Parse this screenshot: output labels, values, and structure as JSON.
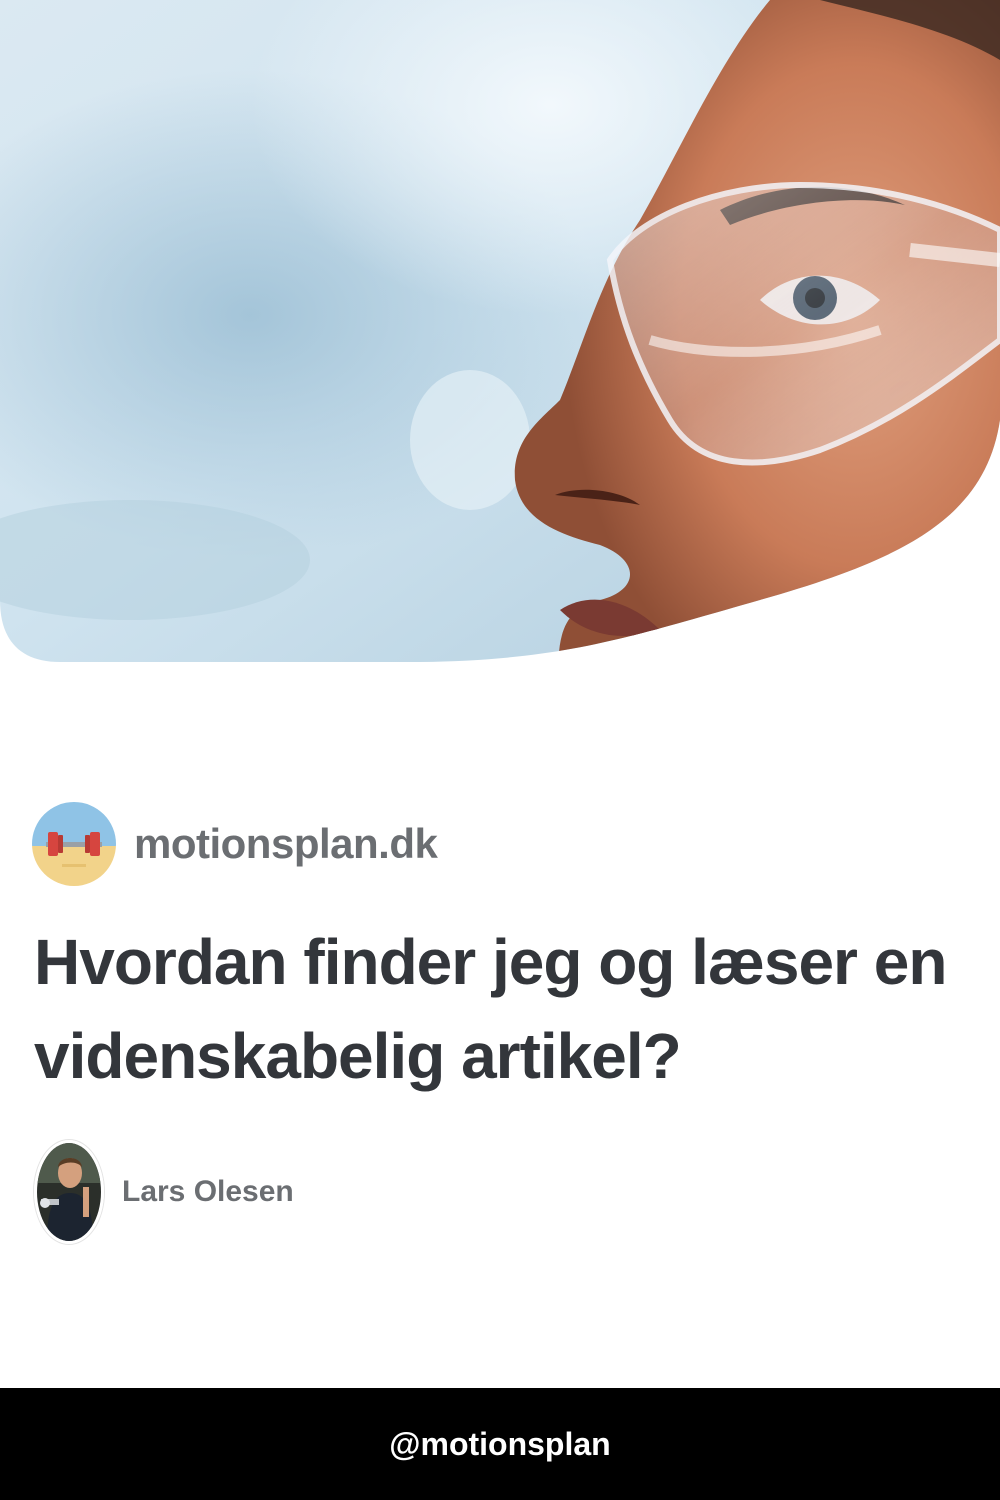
{
  "hero": {
    "image": "scientist-with-safety-glasses-photo"
  },
  "brand": {
    "name": "motionsplan.dk",
    "logo_icon": "dumbbell-icon"
  },
  "article": {
    "title": "Hvordan finder jeg og læser en videnskabelig artikel?"
  },
  "author": {
    "name": "Lars Olesen",
    "avatar": "author-photo"
  },
  "footer": {
    "handle": "@motionsplan"
  },
  "colors": {
    "headline": "#33363b",
    "muted_text": "#6b6e72",
    "footer_bg": "#000000",
    "footer_text": "#ffffff"
  }
}
